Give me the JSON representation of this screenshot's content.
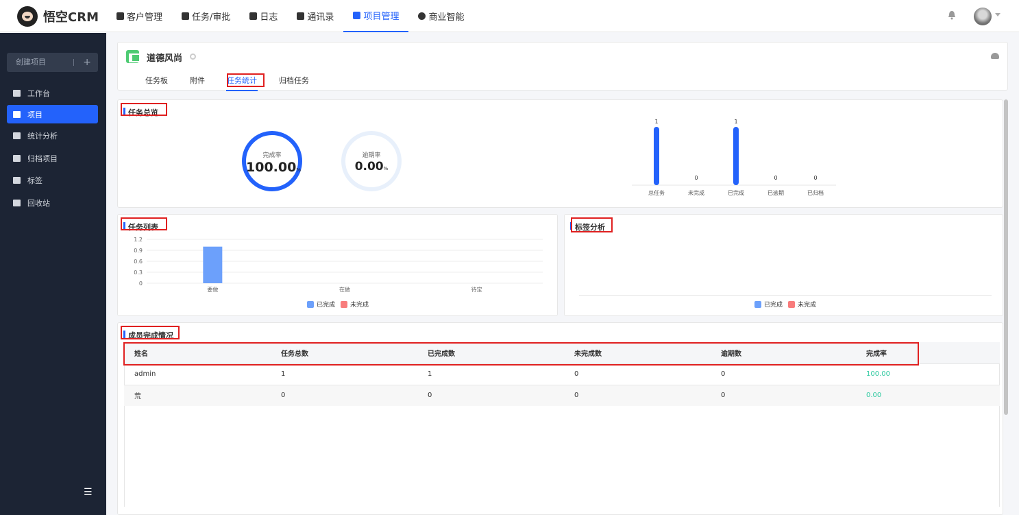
{
  "app": {
    "brand": "悟空CRM"
  },
  "nav": {
    "items": [
      {
        "label": "客户管理"
      },
      {
        "label": "任务/审批"
      },
      {
        "label": "日志"
      },
      {
        "label": "通讯录"
      },
      {
        "label": "项目管理",
        "active": true
      },
      {
        "label": "商业智能"
      }
    ]
  },
  "sidebar": {
    "create_label": "创建项目",
    "create_plus": "+",
    "items": [
      {
        "label": "工作台"
      },
      {
        "label": "项目",
        "active": true
      },
      {
        "label": "统计分析"
      },
      {
        "label": "归档项目"
      },
      {
        "label": "标签"
      },
      {
        "label": "回收站"
      }
    ],
    "collapse_glyph": "☰"
  },
  "project": {
    "name": "道德风尚",
    "tabs": [
      {
        "label": "任务板"
      },
      {
        "label": "附件"
      },
      {
        "label": "任务统计",
        "active": true
      },
      {
        "label": "归档任务"
      }
    ]
  },
  "overview": {
    "title": "任务总览",
    "completion": {
      "label": "完成率",
      "value": "100.00",
      "unit": "%"
    },
    "overdue": {
      "label": "逾期率",
      "value": "0.00",
      "unit": "%"
    }
  },
  "chart_data": [
    {
      "type": "bar",
      "categories": [
        "总任务",
        "未完成",
        "已完成",
        "已逾期",
        "已归档"
      ],
      "values": [
        1,
        0,
        1,
        0,
        0
      ],
      "data_labels": [
        "1",
        "0",
        "1",
        "0",
        "0"
      ],
      "colors": {
        "bar": "#2362fb"
      }
    },
    {
      "type": "bar",
      "title": "任务列表",
      "categories": [
        "要做",
        "在做",
        "待定"
      ],
      "yticks": [
        "1.2",
        "0.9",
        "0.6",
        "0.3",
        "0"
      ],
      "ylim": [
        0,
        1.2
      ],
      "series": [
        {
          "name": "已完成",
          "values": [
            1,
            0,
            0
          ],
          "color": "#6ca0fb"
        },
        {
          "name": "未完成",
          "values": [
            0,
            0,
            0
          ],
          "color": "#f87c7c"
        }
      ],
      "legend": "bottom"
    },
    {
      "type": "bar",
      "title": "标签分析",
      "categories": [],
      "series": [
        {
          "name": "已完成",
          "values": [],
          "color": "#6ca0fb"
        },
        {
          "name": "未完成",
          "values": [],
          "color": "#f87c7c"
        }
      ],
      "legend": "bottom"
    }
  ],
  "members": {
    "title": "成员完成情况",
    "columns": [
      "姓名",
      "任务总数",
      "已完成数",
      "未完成数",
      "逾期数",
      "完成率"
    ],
    "rows": [
      [
        "admin",
        "1",
        "1",
        "0",
        "0",
        "100.00"
      ],
      [
        "荒",
        "0",
        "0",
        "0",
        "0",
        "0.00"
      ]
    ]
  },
  "colors": {
    "accent": "#2362fb",
    "sidebar": "#1c2434",
    "rate": "#2ec9a0",
    "highlight": "#e02020"
  }
}
